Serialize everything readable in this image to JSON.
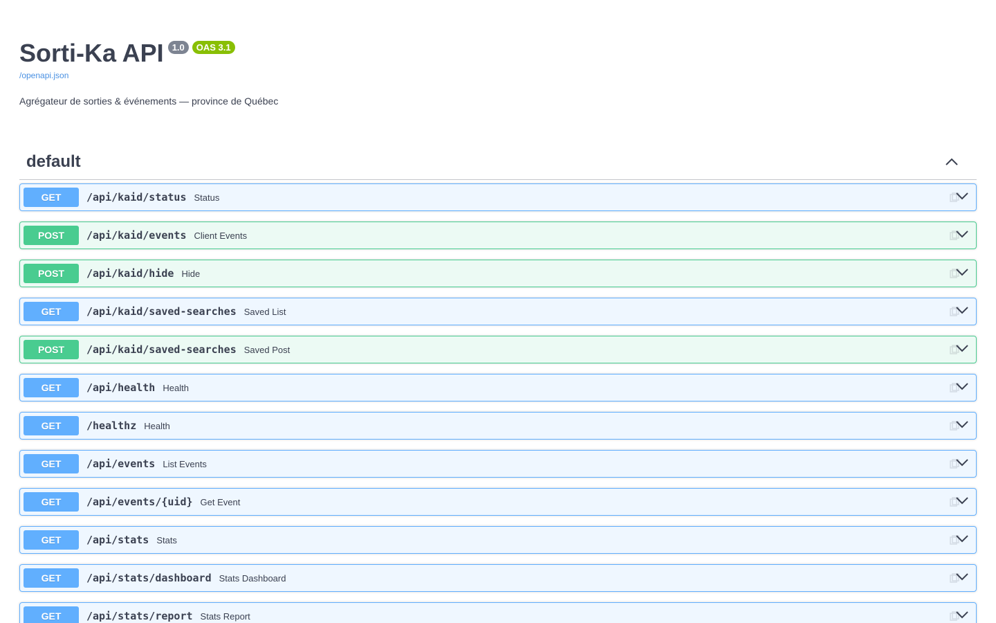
{
  "info": {
    "title": "Sorti-Ka API",
    "version": "1.0",
    "oas": "OAS 3.1",
    "spec_link": "/openapi.json",
    "description": "Agrégateur de sorties & événements — province de Québec"
  },
  "tag": {
    "name": "default"
  },
  "colors": {
    "get": "#61affe",
    "post": "#49cc90",
    "text": "#3b4151",
    "link": "#4990e2",
    "version_badge": "#7d8492",
    "oas_badge": "#89bf04"
  },
  "icons": {
    "collapse": "chevron-up-icon",
    "expand": "chevron-down-icon",
    "copy": "copy-icon"
  },
  "operations": [
    {
      "method": "GET",
      "path": "/api/kaid/status",
      "summary": "Status"
    },
    {
      "method": "POST",
      "path": "/api/kaid/events",
      "summary": "Client Events"
    },
    {
      "method": "POST",
      "path": "/api/kaid/hide",
      "summary": "Hide"
    },
    {
      "method": "GET",
      "path": "/api/kaid/saved-searches",
      "summary": "Saved List"
    },
    {
      "method": "POST",
      "path": "/api/kaid/saved-searches",
      "summary": "Saved Post"
    },
    {
      "method": "GET",
      "path": "/api/health",
      "summary": "Health"
    },
    {
      "method": "GET",
      "path": "/healthz",
      "summary": "Health"
    },
    {
      "method": "GET",
      "path": "/api/events",
      "summary": "List Events"
    },
    {
      "method": "GET",
      "path": "/api/events/{uid}",
      "summary": "Get Event"
    },
    {
      "method": "GET",
      "path": "/api/stats",
      "summary": "Stats"
    },
    {
      "method": "GET",
      "path": "/api/stats/dashboard",
      "summary": "Stats Dashboard"
    },
    {
      "method": "GET",
      "path": "/api/stats/report",
      "summary": "Stats Report"
    }
  ]
}
